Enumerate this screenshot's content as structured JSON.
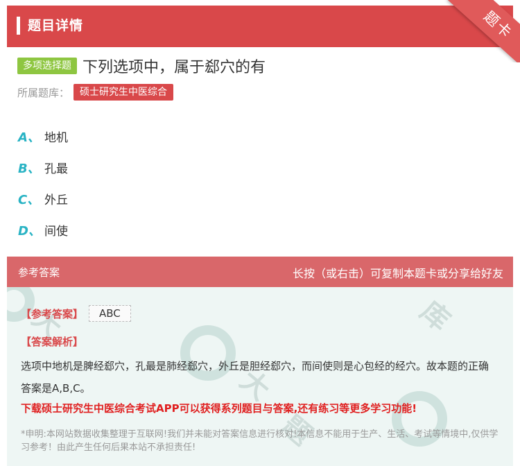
{
  "header": {
    "title": "题目详情"
  },
  "ribbon": {
    "text": "题卡"
  },
  "question": {
    "type": "多项选择题",
    "title": "下列选项中，属于郄穴的有",
    "bank_label": "所属题库：",
    "bank_name": "硕士研究生中医综合"
  },
  "options": [
    {
      "letter": "A、",
      "text": "地机"
    },
    {
      "letter": "B、",
      "text": "孔最"
    },
    {
      "letter": "C、",
      "text": "外丘"
    },
    {
      "letter": "D、",
      "text": "间使"
    }
  ],
  "answer_section": {
    "title": "参考答案",
    "hint": "长按（或右击）可复制本题卡或分享给好友",
    "ref_label": "【参考答案】",
    "ref_value": "ABC",
    "analysis_label": "【答案解析】",
    "analysis_text": "选项中地机是脾经郄穴，孔最是肺经郄穴，外丘是胆经郄穴，而间使则是心包经的经穴。故本题的正确答案是A,B,C。",
    "promo": "下载硕士研究生中医综合考试APP可以获得系列题目与答案,还有练习等更多学习功能!",
    "disclaimer": "*申明:本网站数据收集整理于互联网!我们并未能对答案信息进行核对!本信息不能用于生产、生活、考试等情境中,仅供学习参考！由此产生任何后果本站不承担责任!"
  },
  "colors": {
    "brand_red": "#d9484a",
    "badge_green": "#8ec641",
    "option_letter": "#29b3c4",
    "answer_bg": "#eef6f4"
  }
}
